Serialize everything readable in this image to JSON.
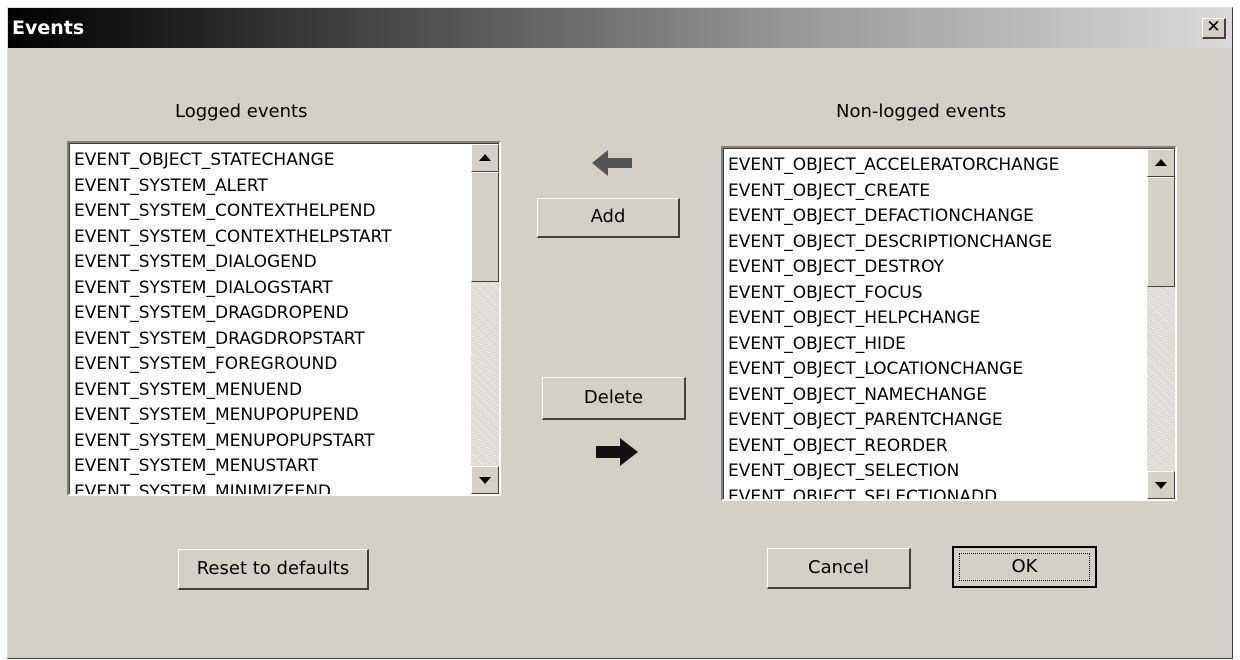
{
  "window": {
    "title": "Events",
    "close_glyph": "✕"
  },
  "logged": {
    "label": "Logged events",
    "items": [
      "EVENT_OBJECT_STATECHANGE",
      "EVENT_SYSTEM_ALERT",
      "EVENT_SYSTEM_CONTEXTHELPEND",
      "EVENT_SYSTEM_CONTEXTHELPSTART",
      "EVENT_SYSTEM_DIALOGEND",
      "EVENT_SYSTEM_DIALOGSTART",
      "EVENT_SYSTEM_DRAGDROPEND",
      "EVENT_SYSTEM_DRAGDROPSTART",
      "EVENT_SYSTEM_FOREGROUND",
      "EVENT_SYSTEM_MENUEND",
      "EVENT_SYSTEM_MENUPOPUPEND",
      "EVENT_SYSTEM_MENUPOPUPSTART",
      "EVENT_SYSTEM_MENUSTART",
      "EVENT_SYSTEM_MINIMIZEEND"
    ]
  },
  "nonlogged": {
    "label": "Non-logged events",
    "items": [
      "EVENT_OBJECT_ACCELERATORCHANGE",
      "EVENT_OBJECT_CREATE",
      "EVENT_OBJECT_DEFACTIONCHANGE",
      "EVENT_OBJECT_DESCRIPTIONCHANGE",
      "EVENT_OBJECT_DESTROY",
      "EVENT_OBJECT_FOCUS",
      "EVENT_OBJECT_HELPCHANGE",
      "EVENT_OBJECT_HIDE",
      "EVENT_OBJECT_LOCATIONCHANGE",
      "EVENT_OBJECT_NAMECHANGE",
      "EVENT_OBJECT_PARENTCHANGE",
      "EVENT_OBJECT_REORDER",
      "EVENT_OBJECT_SELECTION",
      "EVENT_OBJECT_SELECTIONADD"
    ]
  },
  "buttons": {
    "add": "Add",
    "delete": "Delete",
    "reset": "Reset to defaults",
    "cancel": "Cancel",
    "ok": "OK"
  },
  "icons": {
    "left_arrow": "arrow-left-icon",
    "right_arrow": "arrow-right-icon",
    "scroll_up": "triangle-up-icon",
    "scroll_down": "triangle-down-icon"
  },
  "colors": {
    "dialog_bg": "#d4d0c8",
    "title_gradient_start": "#000000",
    "title_gradient_end": "#dadada",
    "arrow": "#333333"
  }
}
